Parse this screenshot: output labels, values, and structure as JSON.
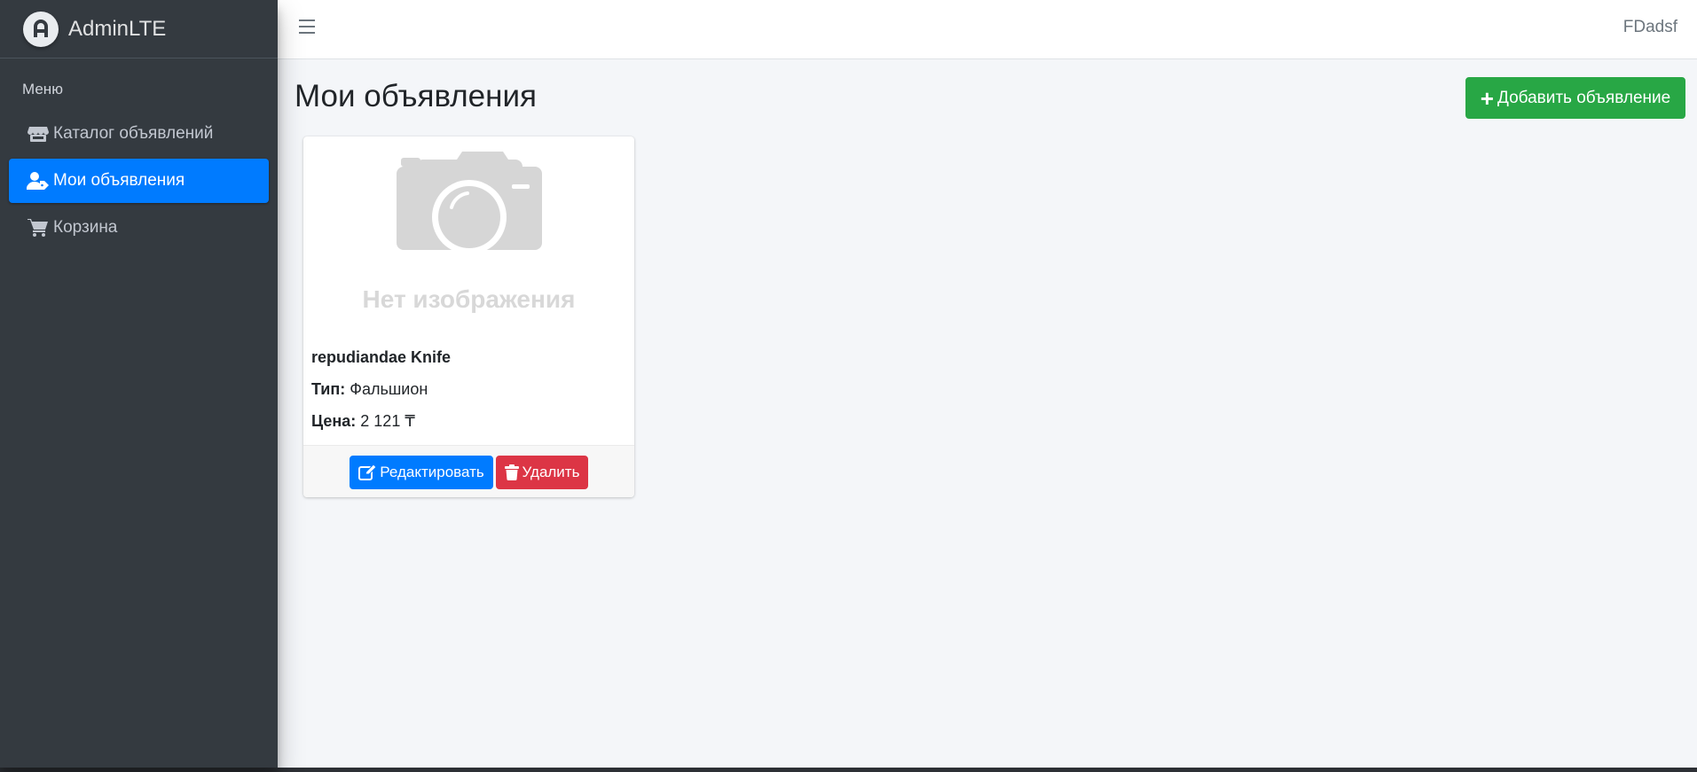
{
  "brand": {
    "name_bold": "Admin",
    "name_light": "LTE",
    "logo_icon": "adminlte-logo-icon"
  },
  "sidebar": {
    "header": "Меню",
    "items": [
      {
        "label": "Каталог объявлений",
        "icon": "store-icon",
        "active": false
      },
      {
        "label": "Мои объявления",
        "icon": "user-tag-icon",
        "active": true
      },
      {
        "label": "Корзина",
        "icon": "shopping-cart-icon",
        "active": false
      }
    ]
  },
  "navbar": {
    "menu_icon": "hamburger-icon",
    "user_name": "FDadsf"
  },
  "main": {
    "title": "Мои объявления",
    "add_button_label": "Добавить объявление",
    "listings": [
      {
        "image_placeholder": "Нет изображения",
        "title": "repudiandae Knife",
        "type_label": "Тип:",
        "type_value": "Фальшион",
        "price_label": "Цена:",
        "price_value": "2 121 ₸",
        "edit_label": "Редактировать",
        "delete_label": "Удалить"
      }
    ]
  },
  "colors": {
    "sidebar_bg": "#343a40",
    "primary": "#007bff",
    "success": "#28a745",
    "danger": "#dc3545",
    "content_bg": "#f4f6f9"
  }
}
